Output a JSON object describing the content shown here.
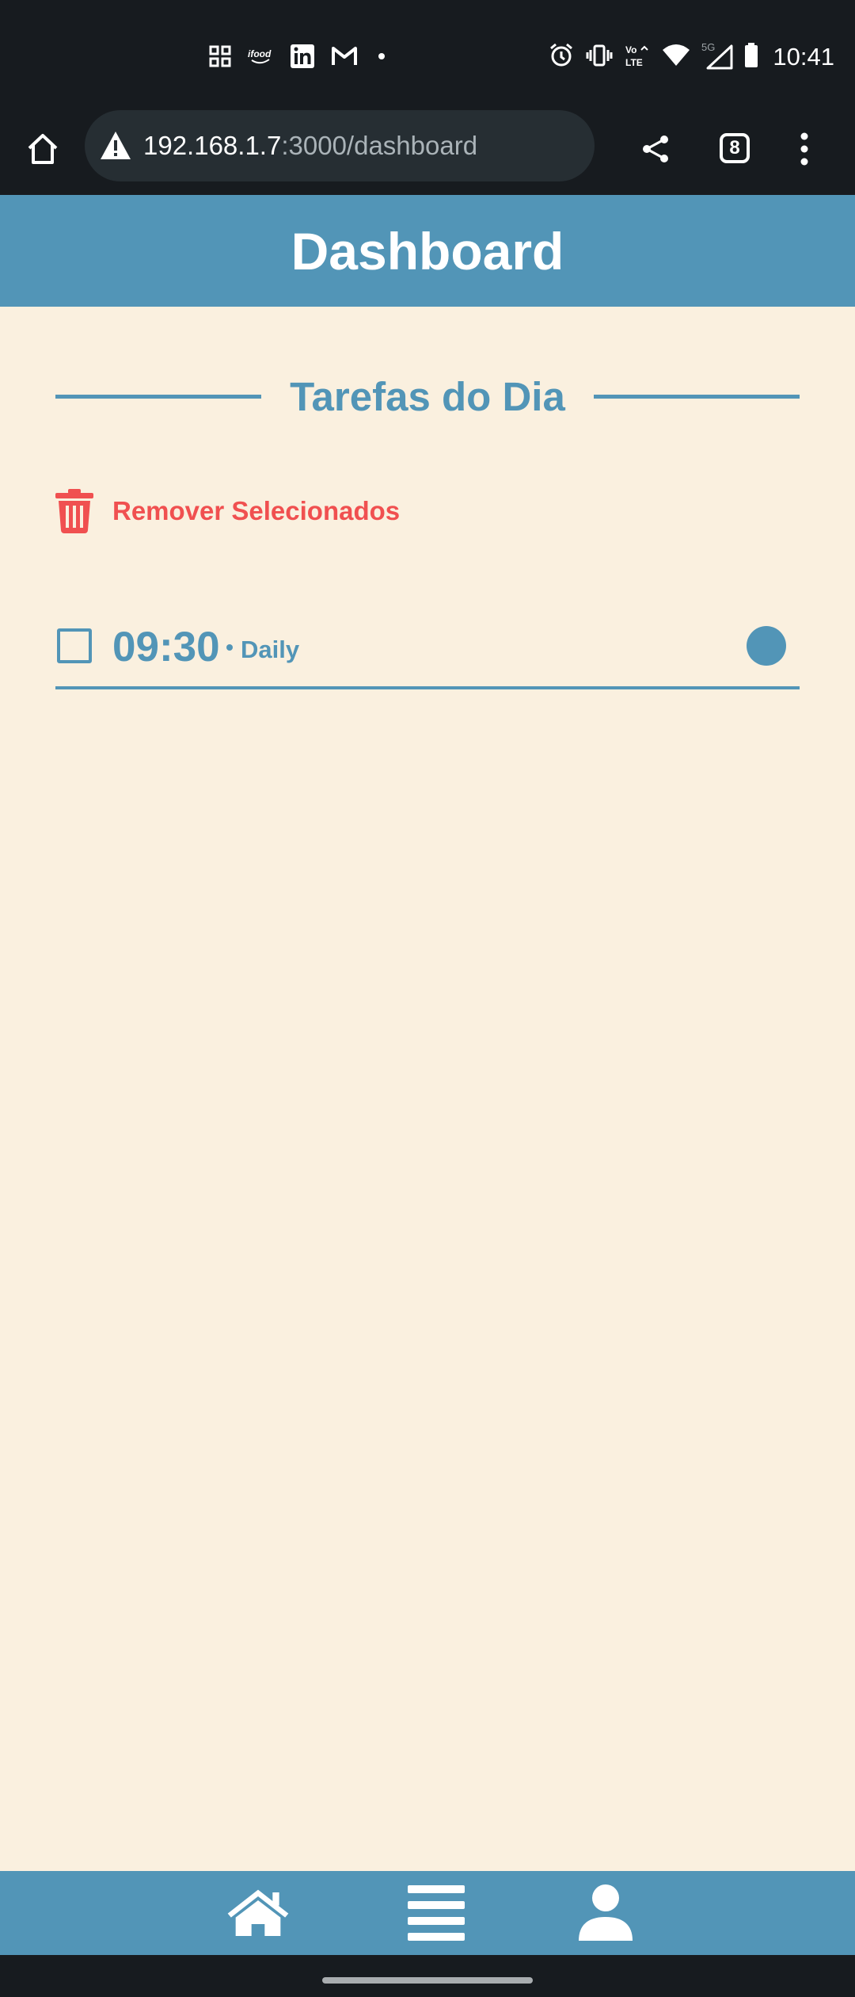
{
  "status_bar": {
    "time": "10:41",
    "network_label": "5G",
    "volte_label": "Vo\nLTE",
    "notification_icons": [
      "grid-icon",
      "ifood-icon",
      "linkedin-icon",
      "gmail-icon",
      "dot-icon"
    ],
    "system_icons": [
      "alarm-icon",
      "vibrate-icon",
      "volte-icon",
      "wifi-icon",
      "signal-icon",
      "battery-icon"
    ]
  },
  "browser": {
    "url_host": "192.168.1.7",
    "url_path": ":3000/dashboard",
    "tab_count": "8",
    "security_icon": "warning-icon"
  },
  "app": {
    "title": "Dashboard",
    "section_title": "Tarefas do Dia",
    "remove_selected_label": "Remover Selecionados",
    "tasks": [
      {
        "time": "09:30",
        "type": "Daily",
        "checked": false
      }
    ]
  },
  "bottom_nav": {
    "items": [
      "home-icon",
      "list-icon",
      "user-icon"
    ]
  },
  "colors": {
    "primary": "#5295b7",
    "danger": "#f05050",
    "background": "#faf0df",
    "system_bar": "#171b1f"
  }
}
